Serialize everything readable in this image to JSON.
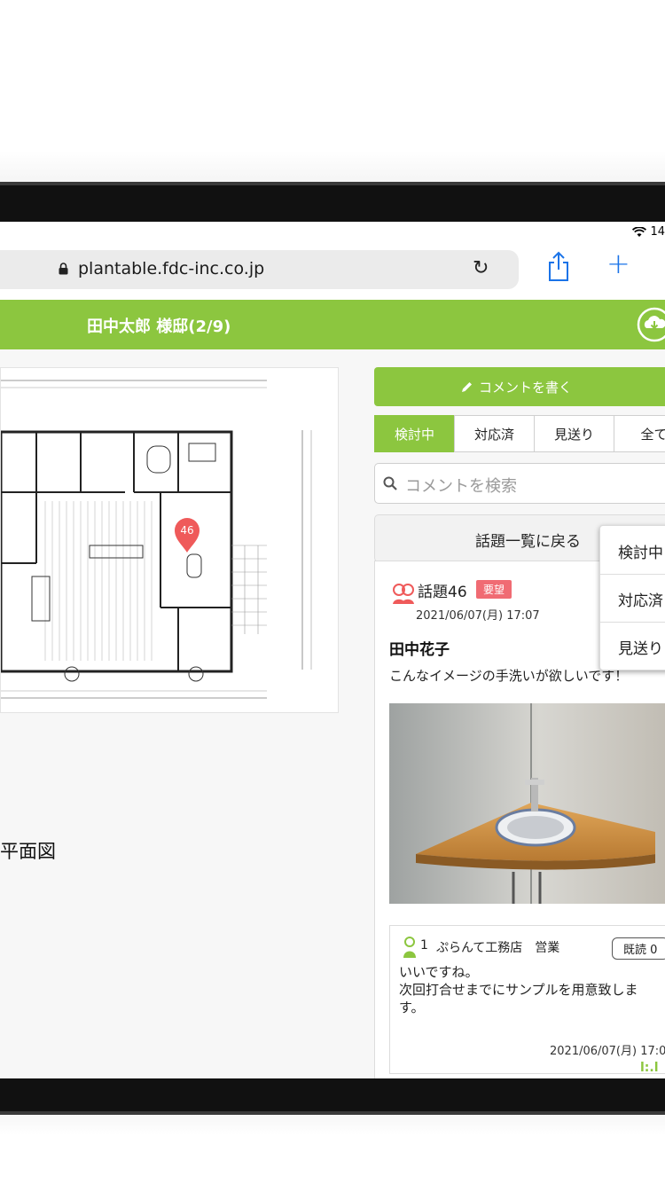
{
  "status_bar": {
    "time": "14"
  },
  "browser": {
    "url": "plantable.fdc-inc.co.jp"
  },
  "app": {
    "title": "田中太郎 様邸(2/9)"
  },
  "floorplan": {
    "label": "平面図",
    "pin_number": "46"
  },
  "comments": {
    "write_label": "コメントを書く",
    "tabs": [
      {
        "label": "検討中",
        "active": true
      },
      {
        "label": "対応済",
        "active": false
      },
      {
        "label": "見送り",
        "active": false
      },
      {
        "label": "全て",
        "active": false
      }
    ],
    "search_placeholder": "コメントを検索",
    "back_label": "話題一覧に戻る",
    "topic": {
      "title": "話題46",
      "badge": "要望",
      "date": "2021/06/07(月) 17:07",
      "author": "田中花子",
      "message": "こんなイメージの手洗いが欲しいです！"
    },
    "reply": {
      "count": "1",
      "author_line": "ぷらんて工務店　営業",
      "read_badge": "既読 0",
      "body_lines": [
        "いいですね。",
        "次回打合せまでにサンプルを用意致しま",
        "す。"
      ],
      "date": "2021/06/07(月) 17:0",
      "mark": "l:.l"
    }
  },
  "dropdown": {
    "items": [
      "検討中",
      "対応済",
      "見送り"
    ]
  },
  "colors": {
    "brand_green": "#8cc63f",
    "badge_red": "#f06b73",
    "link_blue": "#1a73e8"
  }
}
